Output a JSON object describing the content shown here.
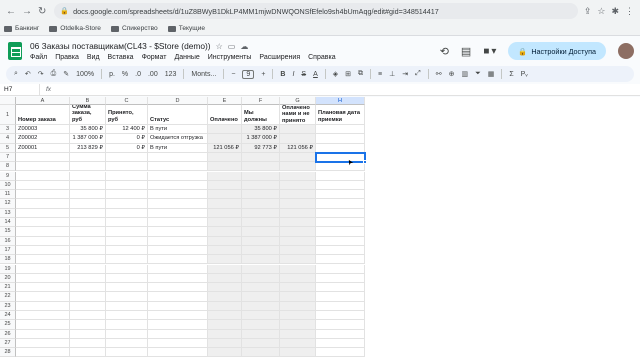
{
  "browser": {
    "url": "docs.google.com/spreadsheets/d/1uZ8BWyB1DkLP4MM1mjwDNWQONSfEfelo9sh4bUmAqg/edit#gid=348514417",
    "bookmarks": [
      "Банкинг",
      "Otdelka-Store",
      "Спикерство",
      "Текущие"
    ]
  },
  "doc": {
    "title": "06 Заказы поставщикам(CL43 - $Store (demo))",
    "menus": [
      "Файл",
      "Правка",
      "Вид",
      "Вставка",
      "Формат",
      "Данные",
      "Инструменты",
      "Расширения",
      "Справка"
    ],
    "share_label": "Настройки Доступа"
  },
  "toolbar": {
    "zoom": "100%",
    "currency": "р.",
    "percent": "%",
    "dec_less": ".0",
    "dec_more": ".00",
    "format_123": "123",
    "font": "Monts...",
    "font_size": "9",
    "bold": "B",
    "italic": "I",
    "strike": "S",
    "text_color": "A"
  },
  "formula_bar": {
    "name_box": "H7",
    "fx": "fx",
    "content": ""
  },
  "sheet": {
    "columns": [
      "A",
      "B",
      "C",
      "D",
      "E",
      "F",
      "G",
      "H"
    ],
    "selected_column": "H",
    "row_numbers": [
      "1",
      "3",
      "4",
      "5",
      "7",
      "8",
      "9",
      "10",
      "11",
      "12",
      "13",
      "14",
      "15",
      "16",
      "17",
      "18",
      "19",
      "20",
      "21",
      "22",
      "23",
      "24",
      "25",
      "26",
      "27",
      "28"
    ],
    "headers": {
      "A": "Номер заказа",
      "B": "Сумма заказа, руб",
      "C": "Принято, руб",
      "D": "Статус",
      "E": "Оплачено",
      "F": "Мы должны",
      "G": "Оплачено нами и не принято",
      "H": "Плановая дата приемки"
    },
    "rows": [
      {
        "A": "Z00003",
        "B": "35 800 ₽",
        "C": "12 400 ₽",
        "D": "В пути",
        "E": "",
        "F": "35 800 ₽",
        "G": "",
        "H": ""
      },
      {
        "A": "Z00002",
        "B": "1 387 000 ₽",
        "C": "0 ₽",
        "D": "Ожидается отгрузка",
        "E": "",
        "F": "1 387 000 ₽",
        "G": "",
        "H": ""
      },
      {
        "A": "Z00001",
        "B": "213 829 ₽",
        "C": "0 ₽",
        "D": "В пути",
        "E": "121 056 ₽",
        "F": "92 773 ₽",
        "G": "121 056 ₽",
        "H": ""
      }
    ]
  }
}
